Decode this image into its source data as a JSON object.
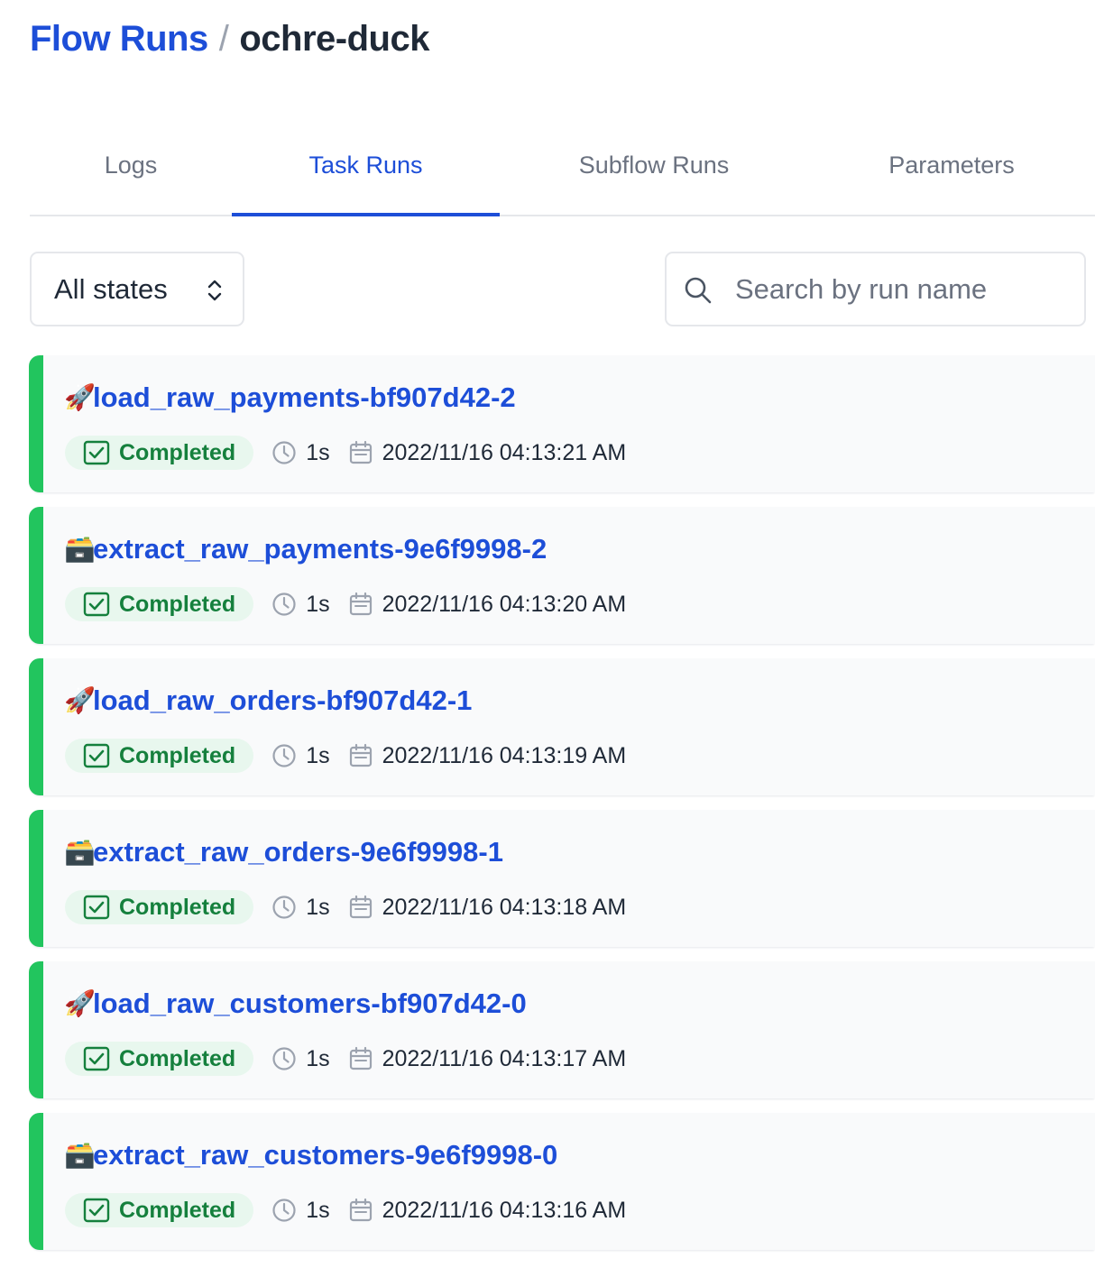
{
  "breadcrumb": {
    "parent": "Flow Runs",
    "separator": "/",
    "current": "ochre-duck"
  },
  "tabs": [
    {
      "label": "Logs",
      "active": false
    },
    {
      "label": "Task Runs",
      "active": true
    },
    {
      "label": "Subflow Runs",
      "active": false
    },
    {
      "label": "Parameters",
      "active": false
    }
  ],
  "filter": {
    "state_select": "All states",
    "search_placeholder": "Search by run name"
  },
  "colors": {
    "accent": "#1d4ed8",
    "completed": "#22c55e",
    "completed_text": "#15803d",
    "completed_bg": "#e8f7ee"
  },
  "runs": [
    {
      "emoji": "🚀",
      "name": "load_raw_payments-bf907d42-2",
      "state": "Completed",
      "duration": "1s",
      "start": "2022/11/16 04:13:21 AM"
    },
    {
      "emoji": "🗃️",
      "name": "extract_raw_payments-9e6f9998-2",
      "state": "Completed",
      "duration": "1s",
      "start": "2022/11/16 04:13:20 AM"
    },
    {
      "emoji": "🚀",
      "name": "load_raw_orders-bf907d42-1",
      "state": "Completed",
      "duration": "1s",
      "start": "2022/11/16 04:13:19 AM"
    },
    {
      "emoji": "🗃️",
      "name": "extract_raw_orders-9e6f9998-1",
      "state": "Completed",
      "duration": "1s",
      "start": "2022/11/16 04:13:18 AM"
    },
    {
      "emoji": "🚀",
      "name": "load_raw_customers-bf907d42-0",
      "state": "Completed",
      "duration": "1s",
      "start": "2022/11/16 04:13:17 AM"
    },
    {
      "emoji": "🗃️",
      "name": "extract_raw_customers-9e6f9998-0",
      "state": "Completed",
      "duration": "1s",
      "start": "2022/11/16 04:13:16 AM"
    }
  ]
}
